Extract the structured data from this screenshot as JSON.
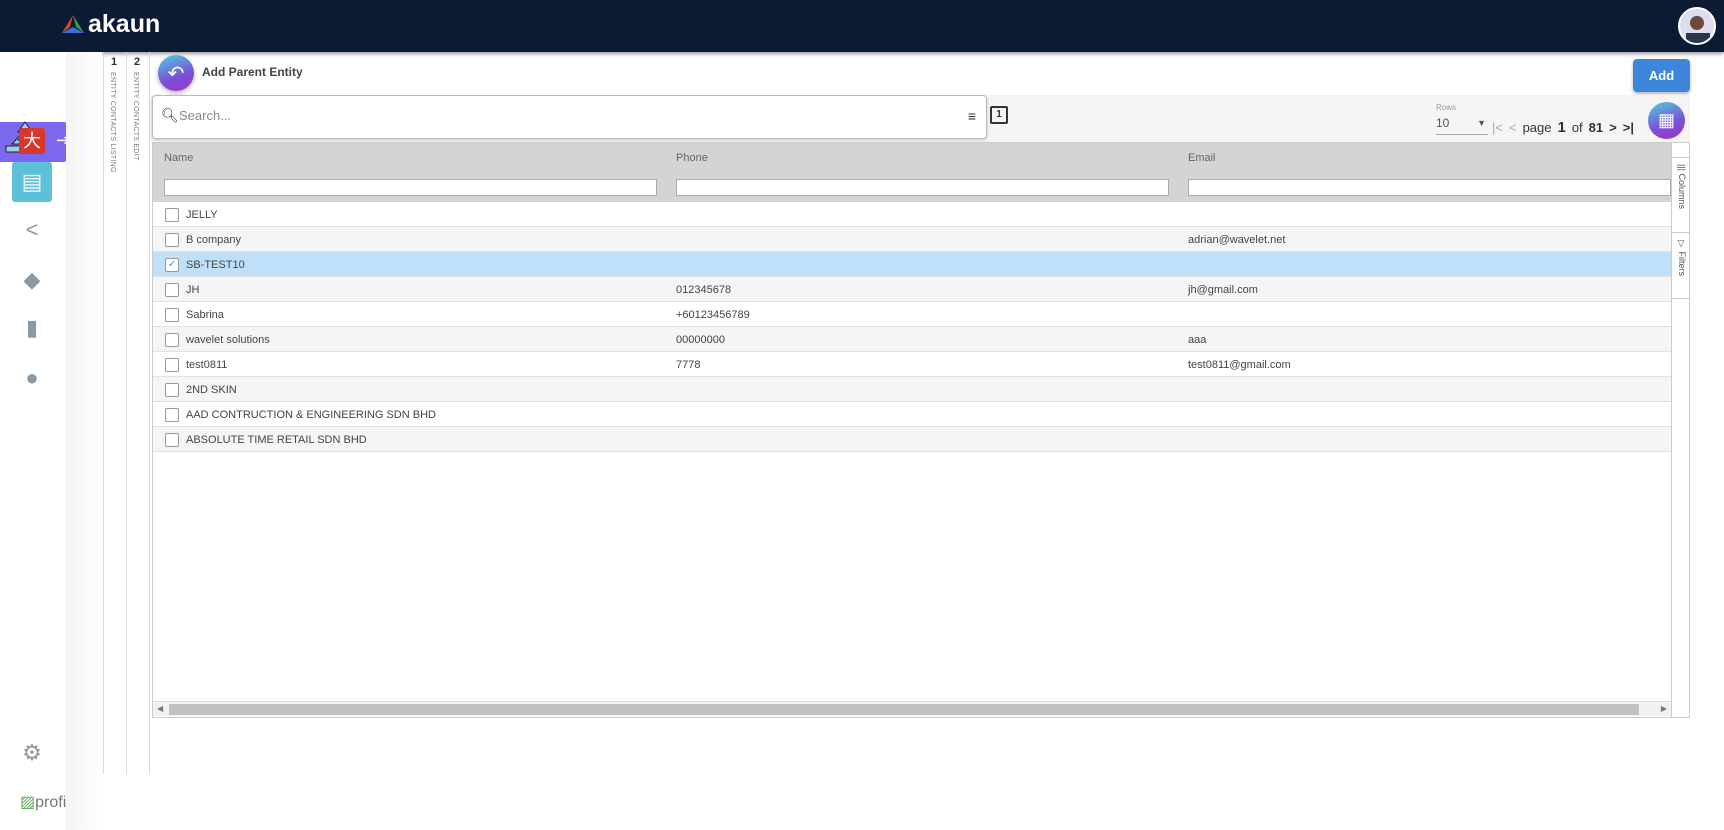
{
  "header": {
    "brand": "akaun"
  },
  "sidebar": {
    "items": [
      "entity-tree",
      "app-red",
      "contacts",
      "share",
      "tags",
      "invoice",
      "dollar"
    ],
    "profile_alt": "profi"
  },
  "steps": [
    {
      "num": "1",
      "label": "ENTITY CONTACTS LISTING"
    },
    {
      "num": "2",
      "label": "ENTITY CONTACTS EDIT"
    }
  ],
  "page": {
    "title": "Add Parent Entity",
    "add_label": "Add"
  },
  "search": {
    "placeholder": "Search..."
  },
  "pager": {
    "rows_label": "Rows",
    "rows_value": "10",
    "page_word": "page",
    "page": "1",
    "of_word": "of",
    "total": "81"
  },
  "grid": {
    "columns": [
      "Name",
      "Phone",
      "Email"
    ],
    "side_tabs": [
      "Columns",
      "Filters"
    ],
    "rows": [
      {
        "name": "JELLY",
        "phone": "",
        "email": "",
        "checked": false
      },
      {
        "name": "B company",
        "phone": "",
        "email": "adrian@wavelet.net",
        "checked": false
      },
      {
        "name": "SB-TEST10",
        "phone": "",
        "email": "",
        "checked": true
      },
      {
        "name": "JH",
        "phone": "012345678",
        "email": "jh@gmail.com",
        "checked": false
      },
      {
        "name": "Sabrina",
        "phone": "+60123456789",
        "email": "",
        "checked": false
      },
      {
        "name": "wavelet solutions",
        "phone": "00000000",
        "email": "aaa",
        "checked": false
      },
      {
        "name": "test0811",
        "phone": "7778",
        "email": "test0811@gmail.com",
        "checked": false
      },
      {
        "name": "2ND SKIN",
        "phone": "",
        "email": "",
        "checked": false
      },
      {
        "name": "AAD CONTRUCTION & ENGINEERING SDN BHD",
        "phone": "",
        "email": "",
        "checked": false
      },
      {
        "name": "ABSOLUTE TIME RETAIL SDN BHD",
        "phone": "",
        "email": "",
        "checked": false
      }
    ]
  },
  "colors": {
    "topbar": "#0c1a33",
    "accent": "#7b68ee",
    "add": "#3d86dc",
    "selected_row": "#bfe0f8"
  }
}
